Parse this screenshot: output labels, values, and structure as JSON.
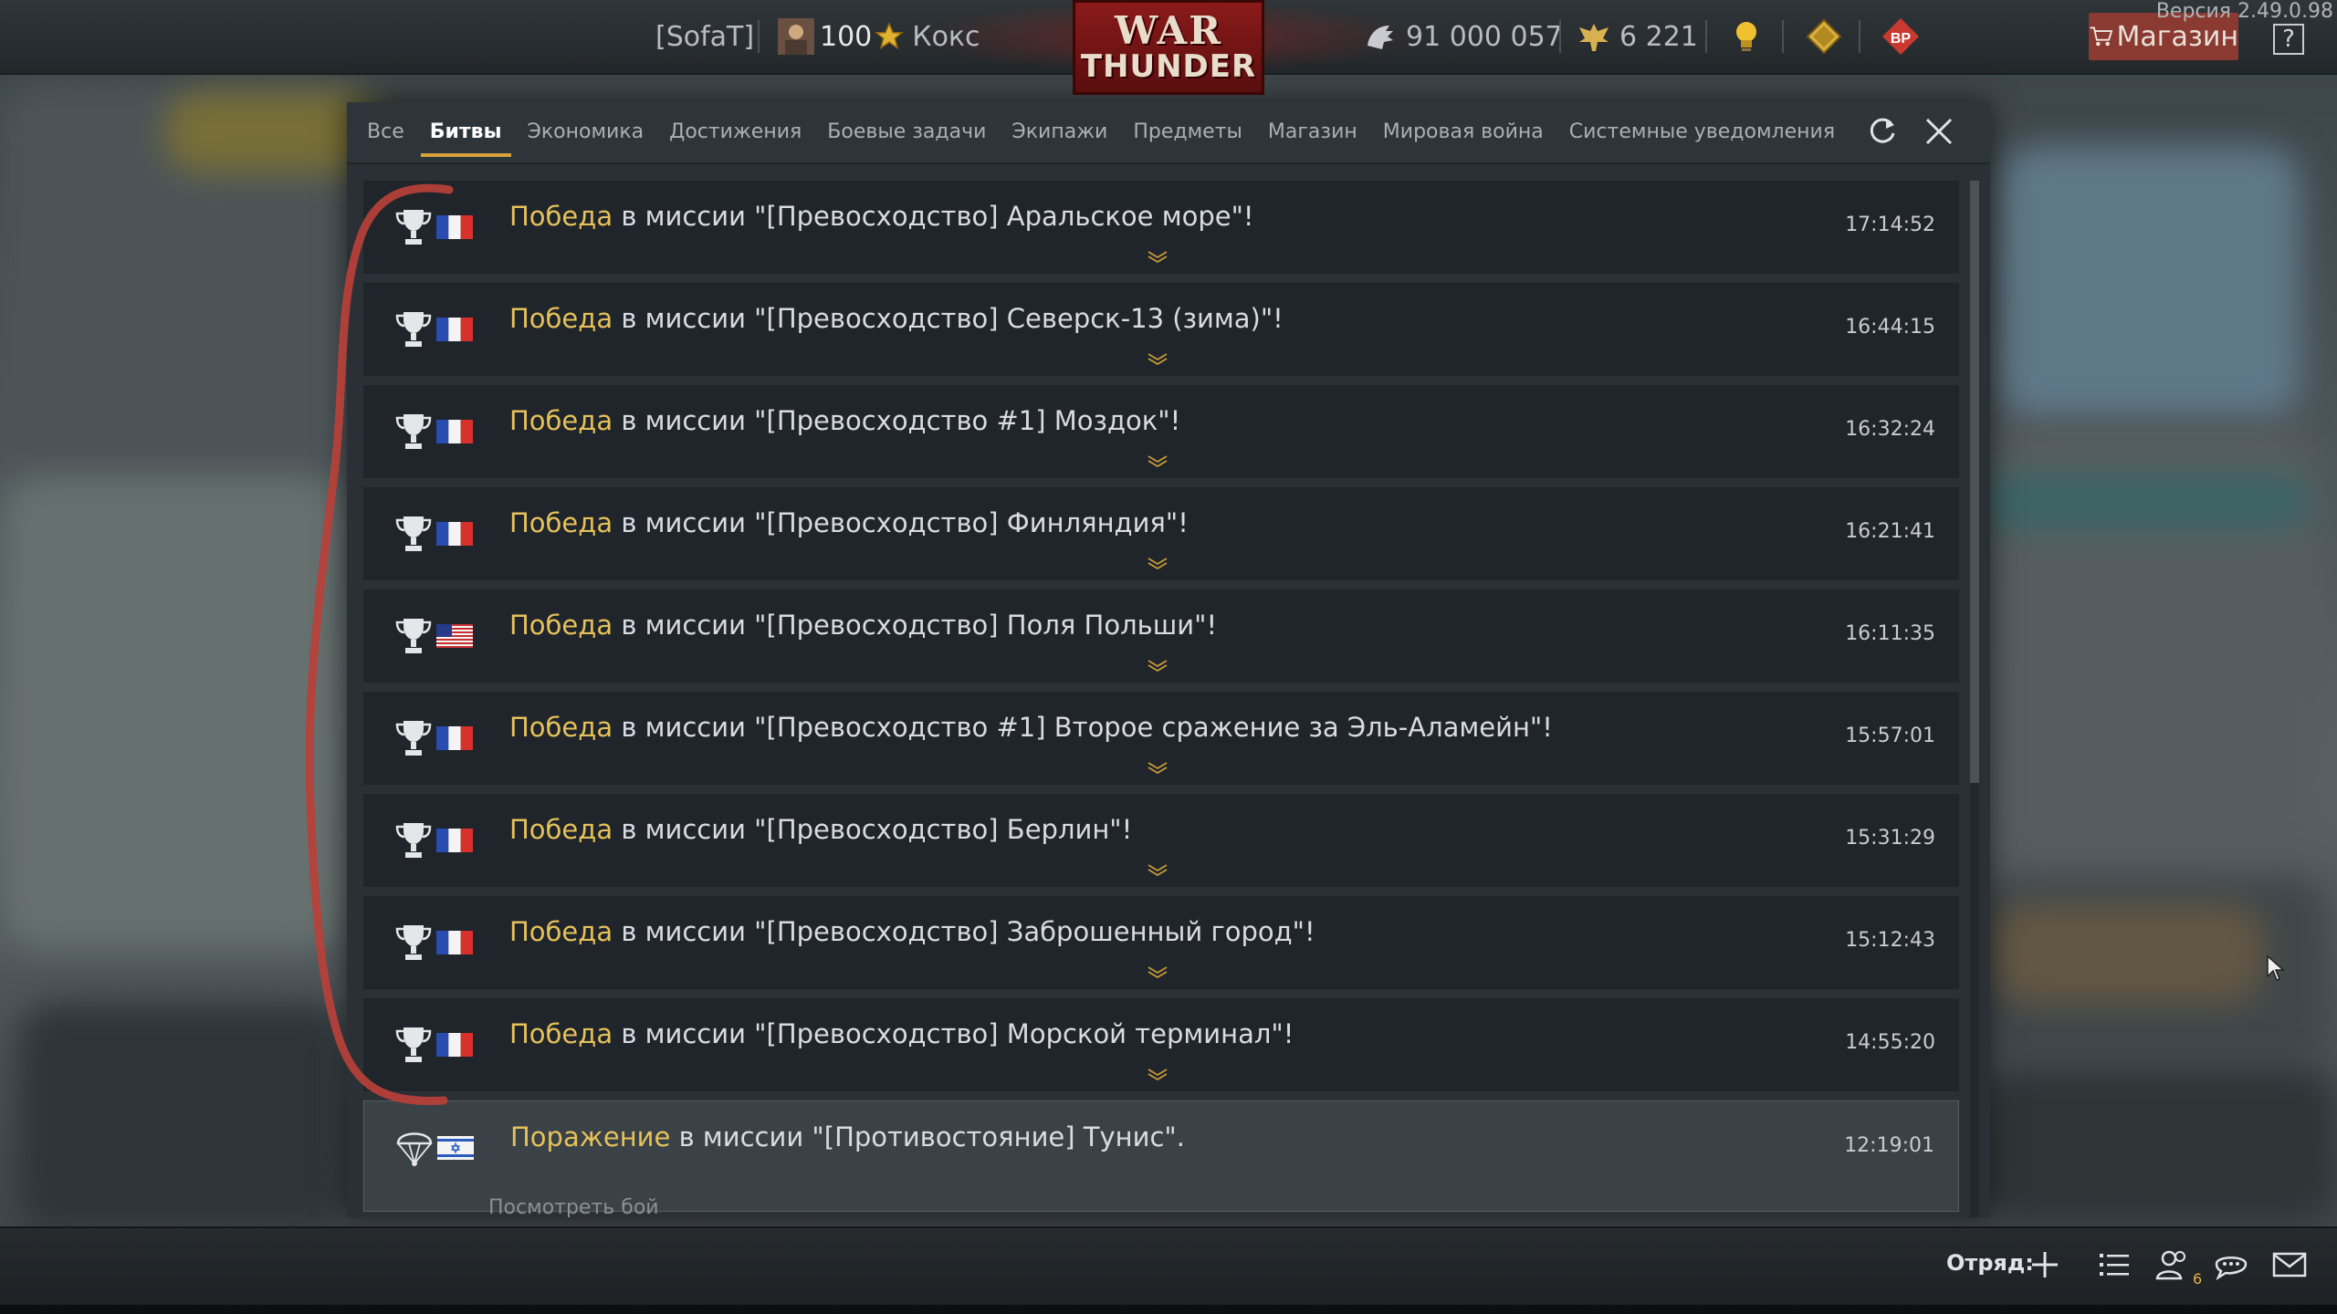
{
  "topbar": {
    "version": "Версия 2.49.0.98",
    "squad_tag": "[SofaT]",
    "level": "100",
    "nickname": "Кокс",
    "logo_line1": "WAR",
    "logo_line2": "THUNDER",
    "silver_lions": "91 000 057",
    "golden_eagles": "6 221",
    "shop_label": "Магазин",
    "help_label": "?"
  },
  "tabs": [
    {
      "label": "Все",
      "active": false
    },
    {
      "label": "Битвы",
      "active": true
    },
    {
      "label": "Экономика",
      "active": false
    },
    {
      "label": "Достижения",
      "active": false
    },
    {
      "label": "Боевые задачи",
      "active": false
    },
    {
      "label": "Экипажи",
      "active": false
    },
    {
      "label": "Предметы",
      "active": false
    },
    {
      "label": "Магазин",
      "active": false
    },
    {
      "label": "Мировая война",
      "active": false
    },
    {
      "label": "Системные уведомления",
      "active": false
    }
  ],
  "notifications": [
    {
      "result": "Победа",
      "text": " в миссии \"[Превосходство] Аральское море\"!",
      "time": "17:14:52",
      "flag": "france"
    },
    {
      "result": "Победа",
      "text": " в миссии \"[Превосходство] Северск-13 (зима)\"!",
      "time": "16:44:15",
      "flag": "france"
    },
    {
      "result": "Победа",
      "text": " в миссии \"[Превосходство #1] Моздок\"!",
      "time": "16:32:24",
      "flag": "france"
    },
    {
      "result": "Победа",
      "text": " в миссии \"[Превосходство] Финляндия\"!",
      "time": "16:21:41",
      "flag": "france"
    },
    {
      "result": "Победа",
      "text": " в миссии \"[Превосходство] Поля Польши\"!",
      "time": "16:11:35",
      "flag": "usa"
    },
    {
      "result": "Победа",
      "text": " в миссии \"[Превосходство #1] Второе сражение за Эль-Аламейн\"!",
      "time": "15:57:01",
      "flag": "france"
    },
    {
      "result": "Победа",
      "text": " в миссии \"[Превосходство] Берлин\"!",
      "time": "15:31:29",
      "flag": "france"
    },
    {
      "result": "Победа",
      "text": " в миссии \"[Превосходство] Заброшенный город\"!",
      "time": "15:12:43",
      "flag": "france"
    },
    {
      "result": "Победа",
      "text": " в миссии \"[Превосходство] Морской терминал\"!",
      "time": "14:55:20",
      "flag": "france"
    },
    {
      "result": "Поражение",
      "text": " в миссии \"[Противостояние] Тунис\".",
      "time": "12:19:01",
      "flag": "israel",
      "sub": "Посмотреть бой"
    }
  ],
  "bottombar": {
    "squad_label": "Отряд:",
    "friends_count": "6"
  },
  "colors": {
    "highlight": "#e6c15a",
    "tab_underline": "#d8a13a",
    "annotation": "#b8403a"
  }
}
